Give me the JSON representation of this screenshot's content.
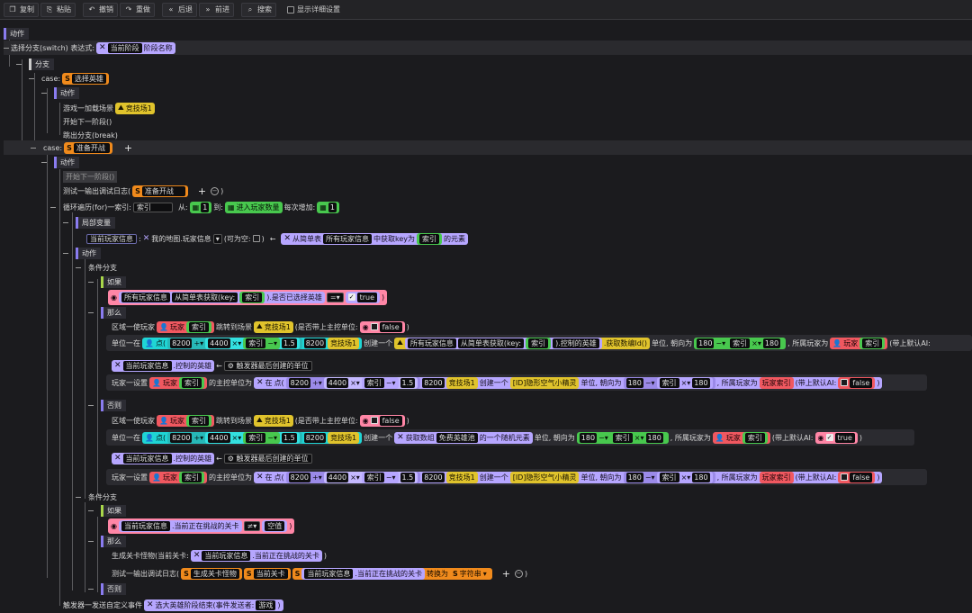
{
  "toolbar": {
    "copy": "复制",
    "paste": "粘贴",
    "undo": "撤销",
    "redo": "重做",
    "back": "后退",
    "forward": "前进",
    "search": "搜索",
    "details": "显示详细设置"
  },
  "t": {
    "actions": "动作",
    "switch": "选择分支(switch) 表达式:",
    "branches": "分支",
    "case": "case:",
    "cur_stage": "当前阶段",
    "stage_name": "阶段名称",
    "choose_hero": "选择英雄",
    "load": "游戏一加载场景",
    "arena": "竞技场1",
    "next_stage": "开始下一阶段()",
    "break": "跳出分支(break)",
    "prepare": "准备开战",
    "log": "测试一输出调试日志(",
    "loop": "循环遍历(for)一索引:",
    "idx": "索引",
    "from": "从:",
    "one": "1",
    "to": "到:",
    "in_players": "进入玩家数量",
    "step": "每次增加:",
    "locals": "局部变量",
    "cur_info": "当前玩家信息",
    "my_map": "我的地图.玩家信息",
    "nullable": "(可为空:",
    "arrow": "←",
    "get_by_key": "从简单表",
    "all_info": "所有玩家信息",
    "key_is": "中获取key为",
    "elem": "的元素",
    "cond": "条件分支",
    "if": "如果",
    "then": "那么",
    "else": "否则",
    "all_info2": "所有玩家信息",
    "get_key": "从简单表获取(key:",
    "picked": ").是否已选择英雄",
    "eq": "=",
    "true": "true",
    "false": "false",
    "tp": "区域一使玩家",
    "player": "玩家",
    "jump": "跳转到场景",
    "keep": "(是否带上主控单位:",
    "unit_at": "单位一在",
    "pt": "点(",
    "n8200": "8200",
    "n4400": "4400",
    "n15": "1.5",
    "n180": "180",
    "create": "创建一个",
    "hero": ").控制的英雄",
    ".get_id": ".获取数编Id()",
    "unit_face": "单位, 朝向为",
    "owner": ", 所属玩家为",
    "ai": "(带上默认AI:",
    "cur_hero": "当前玩家信息",
    "ctrl_hero": ".控制的英雄",
    "trigger": "触发器最后创建的单位",
    "set_ctrl": "玩家一设置",
    "main_unit": "的主控单位为",
    "at": "在",
    "sprite": "[ID]隐形空气小精灵",
    "unit_face2": "单位, 朝向为",
    "owner_of": "玩家索引",
    "rand": "获取数组",
    "free_hero": "免费英雄池",
    "rand2": "的一个随机元素",
    "cur_level": ".当前正在挑战的关卡",
    "neq": "≠",
    "empty": "空值",
    "gen_monster": "生成关卡怪物(当前关卡:",
    "gen_m": "生成关卡怪物",
    "cur_lvl_label": "当前关卡",
    "to_str": "转换为",
    "str": "字符串",
    "event": "触发器一发送自定义事件",
    "event2": "选大英雄阶段结束(事件发送者:",
    "game": "游戏"
  }
}
